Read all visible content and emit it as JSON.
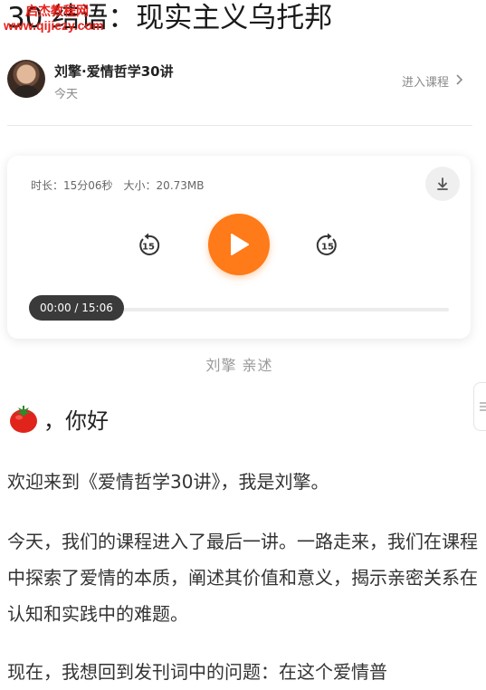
{
  "header": {
    "title": "30 结语：现实主义乌托邦",
    "watermark_line1": "启杰教程网",
    "watermark_line2": "www.qijiezy.com"
  },
  "author": {
    "name": "刘擎·爱情哲学30讲",
    "date": "今天",
    "enter_course": "进入课程"
  },
  "player": {
    "duration_label": "时长：15分06秒",
    "size_label": "大小：20.73MB",
    "time_display": "00:00 / 15:06",
    "progress": 0.0,
    "rewind_seconds": "15",
    "forward_seconds": "15",
    "accent": "#ff7a18",
    "narrator": "刘擎 亲述"
  },
  "article": {
    "greeting": "，你好",
    "p1": "欢迎来到《爱情哲学30讲》，我是刘擎。",
    "p2": "今天，我们的课程进入了最后一讲。一路走来，我们在课程中探索了爱情的本质，阐述其价值和意义，揭示亲密关系在认知和实践中的难题。",
    "p3": "现在，我想回到发刊词中的问题：在这个爱情普"
  }
}
